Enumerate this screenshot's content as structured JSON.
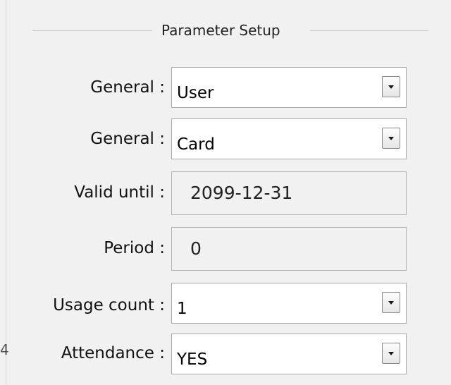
{
  "group": {
    "title": "Parameter Setup"
  },
  "rows": [
    {
      "label": "General :",
      "value": "User",
      "kind": "dropdown"
    },
    {
      "label": "General :",
      "value": "Card",
      "kind": "dropdown"
    },
    {
      "label": "Valid until :",
      "value": "2099-12-31",
      "kind": "readonly"
    },
    {
      "label": "Period :",
      "value": "0",
      "kind": "readonly"
    },
    {
      "label": "Usage count :",
      "value": "1",
      "kind": "dropdown"
    },
    {
      "label": "Attendance :",
      "value": "YES",
      "kind": "dropdown"
    }
  ],
  "stray_text": "4",
  "icons": {
    "dropdown_arrow": "chevron-down-icon"
  }
}
